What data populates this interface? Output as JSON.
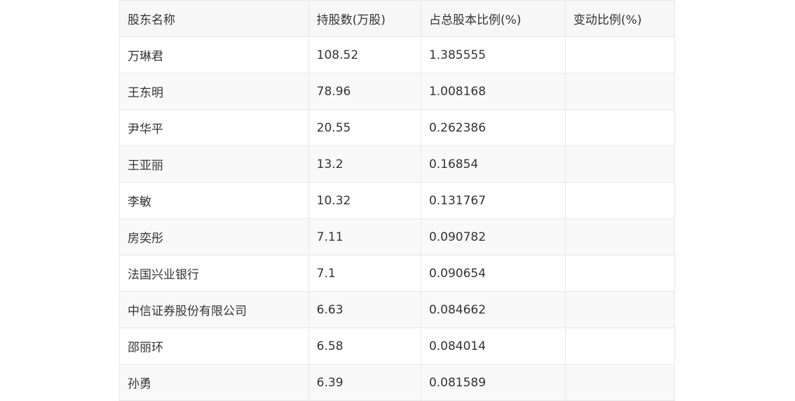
{
  "table": {
    "headers": [
      "股东名称",
      "持股数(万股)",
      "占总股本比例(%)",
      "变动比例(%)"
    ],
    "rows": [
      {
        "name": "万琳君",
        "shares": "108.52",
        "ratio": "1.385555",
        "change": ""
      },
      {
        "name": "王东明",
        "shares": "78.96",
        "ratio": "1.008168",
        "change": ""
      },
      {
        "name": "尹华平",
        "shares": "20.55",
        "ratio": "0.262386",
        "change": ""
      },
      {
        "name": "王亚丽",
        "shares": "13.2",
        "ratio": "0.16854",
        "change": ""
      },
      {
        "name": "李敏",
        "shares": "10.32",
        "ratio": "0.131767",
        "change": ""
      },
      {
        "name": "房奕彤",
        "shares": "7.11",
        "ratio": "0.090782",
        "change": ""
      },
      {
        "name": "法国兴业银行",
        "shares": "7.1",
        "ratio": "0.090654",
        "change": ""
      },
      {
        "name": "中信证券股份有限公司",
        "shares": "6.63",
        "ratio": "0.084662",
        "change": ""
      },
      {
        "name": "邵丽环",
        "shares": "6.58",
        "ratio": "0.084014",
        "change": ""
      },
      {
        "name": "孙勇",
        "shares": "6.39",
        "ratio": "0.081589",
        "change": ""
      }
    ]
  }
}
